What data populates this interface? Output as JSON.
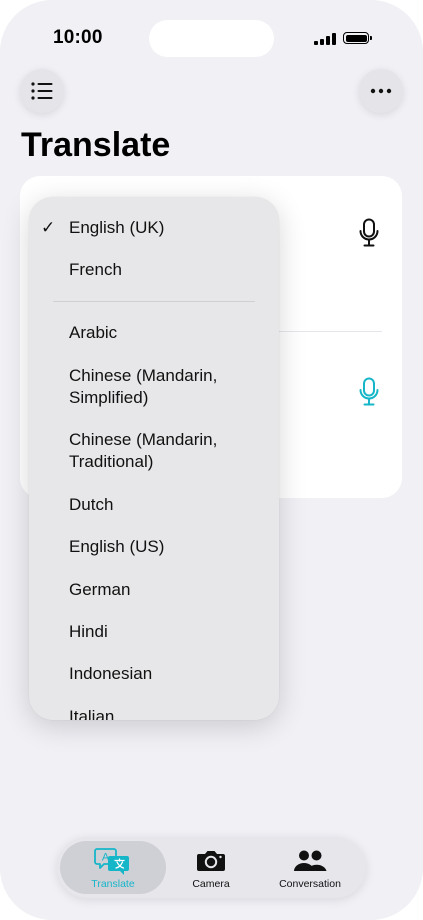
{
  "status_bar": {
    "time": "10:00"
  },
  "header": {
    "list_button_icon": "list-icon",
    "more_button_icon": "ellipsis-icon",
    "title": "Translate"
  },
  "card": {
    "top_mic_icon": "microphone-icon",
    "bottom_mic_icon": "microphone-icon",
    "accent_color": "#16b6c9"
  },
  "language_menu": {
    "selected": "English (UK)",
    "recent": [
      {
        "label": "English (UK)",
        "checked": true
      },
      {
        "label": "French",
        "checked": false
      }
    ],
    "languages": [
      "Arabic",
      "Chinese (Mandarin, Simplified)",
      "Chinese (Mandarin, Traditional)",
      "Dutch",
      "English (US)",
      "German",
      "Hindi",
      "Indonesian",
      "Italian"
    ]
  },
  "tab_bar": {
    "tabs": [
      {
        "label": "Translate",
        "icon": "translate-icon",
        "active": true
      },
      {
        "label": "Camera",
        "icon": "camera-icon",
        "active": false
      },
      {
        "label": "Conversation",
        "icon": "people-icon",
        "active": false
      }
    ]
  }
}
